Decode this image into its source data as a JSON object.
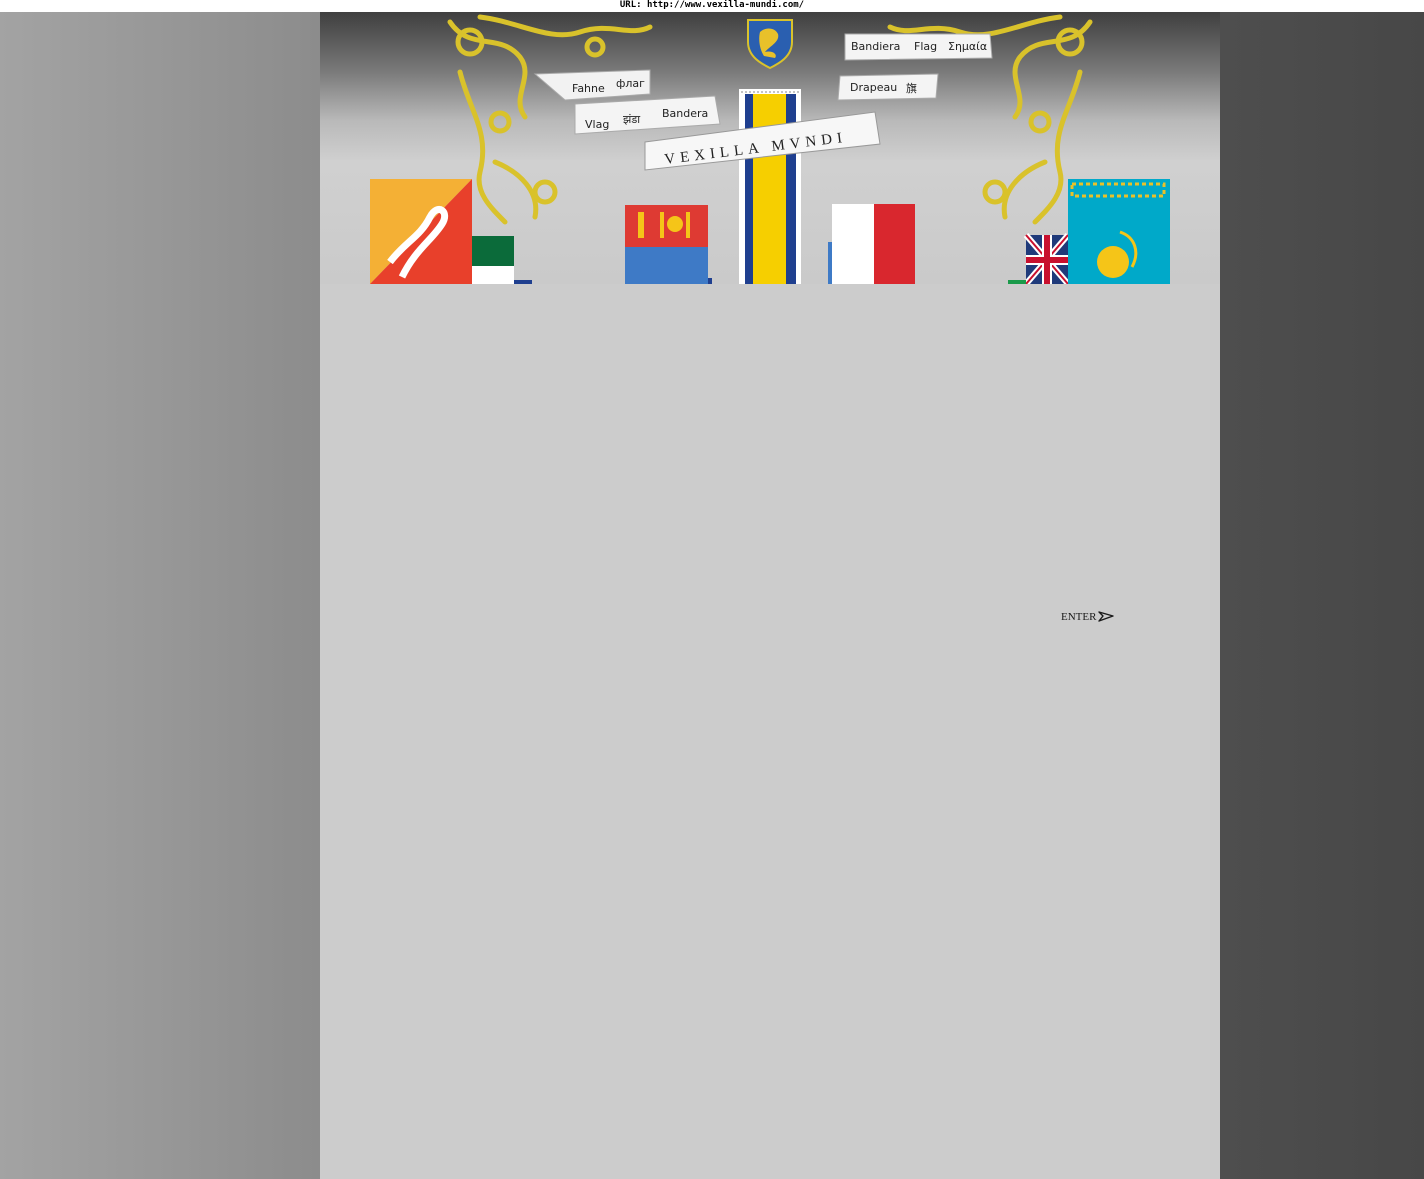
{
  "browser": {
    "url_label": "URL: http://www.vexilla-mundi.com/"
  },
  "banner": {
    "ribbon_words": {
      "fahne": "Fahne",
      "flag_ru": "флаг",
      "vlag": "Vlag",
      "jhanda": "झंडा",
      "bandera": "Bandera",
      "bandiera": "Bandiera",
      "flag": "Flag",
      "simaia": "Σημαία",
      "drapeau": "Drapeau",
      "qi": "旗"
    },
    "title": "VEXILLA MVNDI",
    "emblem_icon": "lion-shield-icon",
    "flags": [
      "bhutan-flag",
      "mexico-flag",
      "mongolia-flag",
      "vatican-flag",
      "malta-flag",
      "uk-flag",
      "kazakhstan-flag"
    ],
    "colors": {
      "gold": "#d9c22b",
      "bhutan_orange": "#f4b035",
      "bhutan_red": "#e8402b",
      "mongolia_red": "#de3a33",
      "mongolia_blue": "#3e7ac6",
      "vatican_yellow": "#f6cf00",
      "malta_red": "#d9272e",
      "kazakh_blue": "#00a9c9"
    }
  },
  "enter": {
    "label": "ENTER",
    "icon": "arrow-right-outline-icon"
  }
}
